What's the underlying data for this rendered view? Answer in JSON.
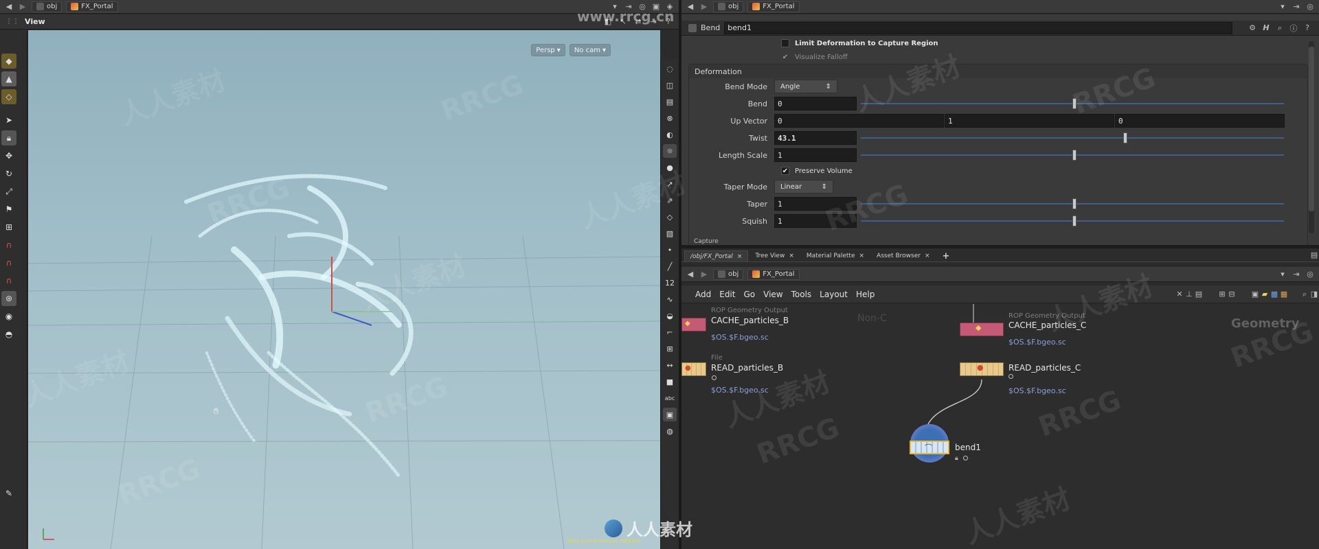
{
  "left_pane": {
    "path": {
      "obj": "obj",
      "network": "FX_Portal"
    },
    "viewer": {
      "title": "View",
      "camera_mode": "Persp",
      "camera": "No cam",
      "status_text": "Non-commercial edition"
    }
  },
  "params": {
    "path": {
      "obj": "obj",
      "network": "FX_Portal"
    },
    "node_type": "Bend",
    "node_name": "bend1",
    "limit_deformation_label": "Limit Deformation to Capture Region",
    "visualize_falloff_label": "Visualize Falloff",
    "section_deformation": "Deformation",
    "bend_mode_label": "Bend Mode",
    "bend_mode_value": "Angle",
    "bend_label": "Bend",
    "bend_value": "0",
    "bend_slider": 0.5,
    "up_vector_label": "Up Vector",
    "up_vector": [
      "0",
      "1",
      "0"
    ],
    "twist_label": "Twist",
    "twist_value": "43.1",
    "twist_slider": 0.62,
    "length_scale_label": "Length Scale",
    "length_scale_value": "1",
    "length_scale_slider": 0.5,
    "preserve_volume_label": "Preserve Volume",
    "taper_mode_label": "Taper Mode",
    "taper_mode_value": "Linear",
    "taper_label": "Taper",
    "taper_value": "1",
    "taper_slider": 0.5,
    "squish_label": "Squish",
    "squish_value": "1",
    "squish_slider": 0.5,
    "section_capture": "Capture"
  },
  "network": {
    "tabs": [
      "/obj/FX_Portal",
      "Tree View",
      "Material Palette",
      "Asset Browser"
    ],
    "path": {
      "obj": "obj",
      "network": "FX_Portal"
    },
    "menu": [
      "Add",
      "Edit",
      "Go",
      "View",
      "Tools",
      "Layout",
      "Help"
    ],
    "ghost_text_1": "Non-C",
    "ghost_text_2": "Geometry",
    "nodes": {
      "cache_b": {
        "type": "ROP Geometry Output",
        "name": "CACHE_particles_B",
        "path": "$OS.$F.bgeo.sc"
      },
      "cache_c": {
        "type": "ROP Geometry Output",
        "name": "CACHE_particles_C",
        "path": "$OS.$F.bgeo.sc"
      },
      "read_b": {
        "type": "File",
        "name": "READ_particles_B",
        "path": "$OS.$F.bgeo.sc"
      },
      "read_c": {
        "type": "File",
        "name": "READ_particles_C",
        "path": "$OS.$F.bgeo.sc"
      },
      "bend": {
        "name": "bend1"
      }
    }
  },
  "watermarks": {
    "rrcg": "RRCG",
    "cn": "人人素材",
    "url": "www.rrcg.cn"
  },
  "colors": {
    "rop_node": "#c45a75",
    "file_node": "#e9c98a",
    "bend_node": "#4a86c9",
    "slider_track": "#3d5e8f"
  }
}
